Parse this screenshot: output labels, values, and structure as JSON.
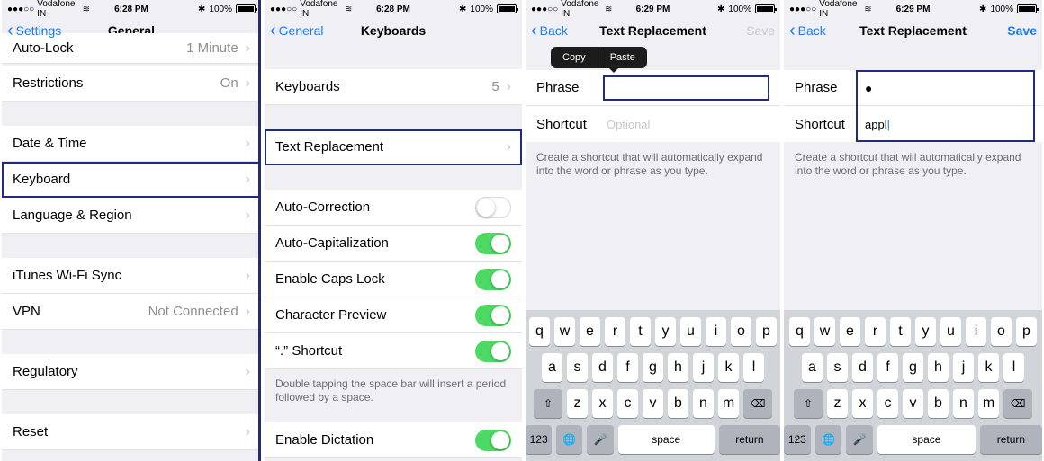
{
  "status": {
    "carrier": "Vodafone IN",
    "battery": "100%",
    "times": [
      "6:28 PM",
      "6:28 PM",
      "6:29 PM",
      "6:29 PM"
    ]
  },
  "general": {
    "back": "Settings",
    "title": "General",
    "rows": [
      {
        "label": "Auto-Lock",
        "value": "1 Minute"
      },
      {
        "label": "Restrictions",
        "value": "On"
      },
      {
        "label": "Date & Time",
        "value": ""
      },
      {
        "label": "Keyboard",
        "value": ""
      },
      {
        "label": "Language & Region",
        "value": ""
      },
      {
        "label": "iTunes Wi-Fi Sync",
        "value": ""
      },
      {
        "label": "VPN",
        "value": "Not Connected"
      },
      {
        "label": "Regulatory",
        "value": ""
      },
      {
        "label": "Reset",
        "value": ""
      }
    ]
  },
  "keyboards": {
    "back": "General",
    "title": "Keyboards",
    "keyboards_label": "Keyboards",
    "keyboards_count": "5",
    "text_replacement": "Text Replacement",
    "toggles": [
      {
        "label": "Auto-Correction",
        "on": false
      },
      {
        "label": "Auto-Capitalization",
        "on": true
      },
      {
        "label": "Enable Caps Lock",
        "on": true
      },
      {
        "label": "Character Preview",
        "on": true
      },
      {
        "label": "“.” Shortcut",
        "on": true
      }
    ],
    "shortcut_note": "Double tapping the space bar will insert a period followed by a space.",
    "dictation": "Enable Dictation",
    "dictation_on": true
  },
  "text_replacement": {
    "back": "Back",
    "title": "Text Replacement",
    "save": "Save",
    "phrase_label": "Phrase",
    "shortcut_label": "Shortcut",
    "shortcut_placeholder": "Optional",
    "hint": "Create a shortcut that will automatically expand into the word or phrase as you type.",
    "copy": "Copy",
    "paste": "Paste",
    "filled_phrase": "",
    "filled_shortcut": "appl"
  },
  "keyboard": {
    "row1": [
      "q",
      "w",
      "e",
      "r",
      "t",
      "y",
      "u",
      "i",
      "o",
      "p"
    ],
    "row2": [
      "a",
      "s",
      "d",
      "f",
      "g",
      "h",
      "j",
      "k",
      "l"
    ],
    "row3": [
      "z",
      "x",
      "c",
      "v",
      "b",
      "n",
      "m"
    ],
    "num": "123",
    "space": "space",
    "return": "return"
  },
  "colors": {
    "accent": "#1a7cf6",
    "toggle_on": "#4cd964",
    "highlight": "#222a7a"
  }
}
